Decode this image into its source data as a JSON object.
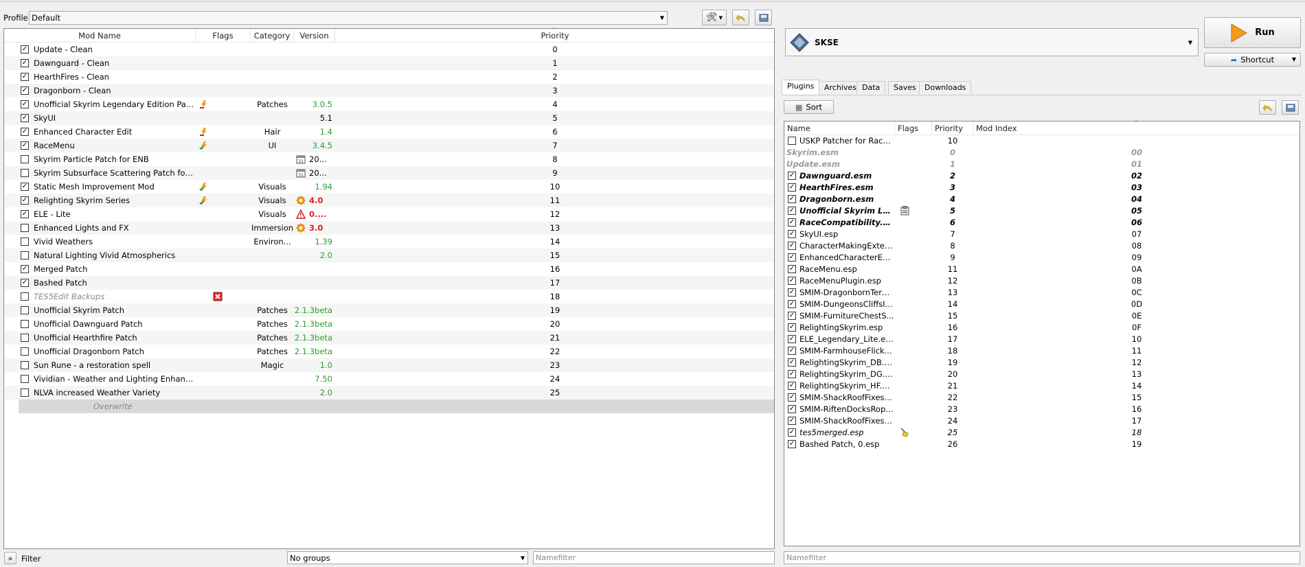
{
  "profile": {
    "label": "Profile",
    "value": "Default"
  },
  "modlist": {
    "columns": {
      "name": "Mod Name",
      "flags": "Flags",
      "category": "Category",
      "version": "Version",
      "priority": "Priority"
    },
    "rows": [
      {
        "checked": true,
        "name": "Update - Clean",
        "flag": "",
        "category": "",
        "version": "",
        "vstyle": "",
        "priority": "0"
      },
      {
        "checked": true,
        "name": "Dawnguard - Clean",
        "flag": "",
        "category": "",
        "version": "",
        "vstyle": "",
        "priority": "1"
      },
      {
        "checked": true,
        "name": "HearthFires - Clean",
        "flag": "",
        "category": "",
        "version": "",
        "vstyle": "",
        "priority": "2"
      },
      {
        "checked": true,
        "name": "Dragonborn - Clean",
        "flag": "",
        "category": "",
        "version": "",
        "vstyle": "",
        "priority": "3"
      },
      {
        "checked": true,
        "name": "Unofficial Skyrim Legendary Edition Patch",
        "flag": "conflict",
        "category": "Patches",
        "version": "3.0.5",
        "vstyle": "green",
        "priority": "4"
      },
      {
        "checked": true,
        "name": "SkyUI",
        "flag": "",
        "category": "",
        "version": "5.1",
        "vstyle": "",
        "priority": "5"
      },
      {
        "checked": true,
        "name": "Enhanced Character Edit",
        "flag": "conflict",
        "category": "Hair",
        "version": "1.4",
        "vstyle": "green",
        "priority": "6"
      },
      {
        "checked": true,
        "name": "RaceMenu",
        "flag": "conflict-green",
        "category": "UI",
        "version": "3.4.5",
        "vstyle": "green",
        "priority": "7"
      },
      {
        "checked": false,
        "name": "Skyrim Particle Patch for ENB",
        "flag": "",
        "category": "",
        "version": "20...",
        "vstyle": "",
        "vicon": "date",
        "priority": "8"
      },
      {
        "checked": false,
        "name": "Skyrim Subsurface Scattering Patch for ENB",
        "flag": "",
        "category": "",
        "version": "20...",
        "vstyle": "",
        "vicon": "date",
        "priority": "9"
      },
      {
        "checked": true,
        "name": "Static Mesh Improvement Mod",
        "flag": "conflict-green",
        "category": "Visuals",
        "version": "1.94",
        "vstyle": "green",
        "priority": "10"
      },
      {
        "checked": true,
        "name": "Relighting Skyrim Series",
        "flag": "conflict-green",
        "category": "Visuals",
        "version": "4.0",
        "vstyle": "red",
        "vicon": "update",
        "priority": "11"
      },
      {
        "checked": true,
        "name": "ELE - Lite",
        "flag": "",
        "category": "Visuals",
        "version": "0....",
        "vstyle": "red",
        "vicon": "warn",
        "priority": "12"
      },
      {
        "checked": false,
        "name": "Enhanced Lights and FX",
        "flag": "",
        "category": "Immersion",
        "version": "3.0",
        "vstyle": "red",
        "vicon": "update",
        "priority": "13"
      },
      {
        "checked": false,
        "name": "Vivid Weathers",
        "flag": "",
        "category": "Environ...",
        "version": "1.39",
        "vstyle": "green",
        "priority": "14"
      },
      {
        "checked": false,
        "name": "Natural Lighting Vivid Atmospherics",
        "flag": "",
        "category": "",
        "version": "2.0",
        "vstyle": "green",
        "priority": "15"
      },
      {
        "checked": true,
        "name": "Merged Patch",
        "flag": "",
        "category": "",
        "version": "",
        "vstyle": "",
        "priority": "16"
      },
      {
        "checked": true,
        "name": "Bashed Patch",
        "flag": "",
        "category": "",
        "version": "",
        "vstyle": "",
        "priority": "17"
      },
      {
        "checked": false,
        "name": "TES5Edit Backups",
        "flag": "invalid",
        "category": "",
        "version": "",
        "vstyle": "",
        "priority": "18",
        "italic": true
      },
      {
        "checked": false,
        "name": "Unofficial Skyrim Patch",
        "flag": "",
        "category": "Patches",
        "version": "2.1.3beta",
        "vstyle": "green",
        "priority": "19"
      },
      {
        "checked": false,
        "name": "Unofficial Dawnguard Patch",
        "flag": "",
        "category": "Patches",
        "version": "2.1.3beta",
        "vstyle": "green",
        "priority": "20"
      },
      {
        "checked": false,
        "name": "Unofficial Hearthfire Patch",
        "flag": "",
        "category": "Patches",
        "version": "2.1.3beta",
        "vstyle": "green",
        "priority": "21"
      },
      {
        "checked": false,
        "name": "Unofficial Dragonborn Patch",
        "flag": "",
        "category": "Patches",
        "version": "2.1.3beta",
        "vstyle": "green",
        "priority": "22"
      },
      {
        "checked": false,
        "name": "Sun Rune - a restoration spell",
        "flag": "",
        "category": "Magic",
        "version": "1.0",
        "vstyle": "green",
        "priority": "23"
      },
      {
        "checked": false,
        "name": "Vividian - Weather and Lighting Enhance...",
        "flag": "",
        "category": "",
        "version": "7.50",
        "vstyle": "green",
        "priority": "24"
      },
      {
        "checked": false,
        "name": "NLVA increased Weather Variety",
        "flag": "",
        "category": "",
        "version": "2.0",
        "vstyle": "green",
        "priority": "25"
      }
    ],
    "overwrite": "Overwrite"
  },
  "filter": {
    "toggle": "»",
    "label": "Filter",
    "groups": "No groups",
    "namefilter_placeholder": "Namefilter"
  },
  "executable": {
    "name": "SKSE",
    "run": "Run",
    "shortcut": "Shortcut"
  },
  "tabs": [
    "Plugins",
    "Archives",
    "Data",
    "Saves",
    "Downloads"
  ],
  "plugins": {
    "sort": "Sort",
    "columns": {
      "name": "Name",
      "flags": "Flags",
      "priority": "Priority",
      "modindex": "Mod Index"
    },
    "rows": [
      {
        "checked": false,
        "name": "USKP Patcher for RaceC...",
        "priority": "10",
        "index": "",
        "style": ""
      },
      {
        "checked": null,
        "name": "Skyrim.esm",
        "priority": "0",
        "index": "00",
        "style": "greybi"
      },
      {
        "checked": null,
        "name": "Update.esm",
        "priority": "1",
        "index": "01",
        "style": "greybi"
      },
      {
        "checked": true,
        "name": "Dawnguard.esm",
        "priority": "2",
        "index": "02",
        "style": "bi"
      },
      {
        "checked": true,
        "name": "HearthFires.esm",
        "priority": "3",
        "index": "03",
        "style": "bi"
      },
      {
        "checked": true,
        "name": "Dragonborn.esm",
        "priority": "4",
        "index": "04",
        "style": "bi"
      },
      {
        "checked": true,
        "name": "Unofficial Skyrim Leg...",
        "priority": "5",
        "index": "05",
        "style": "bi",
        "flag": "clipboard"
      },
      {
        "checked": true,
        "name": "RaceCompatibility.esm",
        "priority": "6",
        "index": "06",
        "style": "bi"
      },
      {
        "checked": true,
        "name": "SkyUI.esp",
        "priority": "7",
        "index": "07",
        "style": ""
      },
      {
        "checked": true,
        "name": "CharacterMakingExtend...",
        "priority": "8",
        "index": "08",
        "style": ""
      },
      {
        "checked": true,
        "name": "EnhancedCharacterEdit....",
        "priority": "9",
        "index": "09",
        "style": ""
      },
      {
        "checked": true,
        "name": "RaceMenu.esp",
        "priority": "11",
        "index": "0A",
        "style": ""
      },
      {
        "checked": true,
        "name": "RaceMenuPlugin.esp",
        "priority": "12",
        "index": "0B",
        "style": ""
      },
      {
        "checked": true,
        "name": "SMIM-DragonbornTern...",
        "priority": "13",
        "index": "0C",
        "style": ""
      },
      {
        "checked": true,
        "name": "SMIM-DungeonsCliffsIc...",
        "priority": "14",
        "index": "0D",
        "style": ""
      },
      {
        "checked": true,
        "name": "SMIM-FurnitureChestS...",
        "priority": "15",
        "index": "0E",
        "style": ""
      },
      {
        "checked": true,
        "name": "RelightingSkyrim.esp",
        "priority": "16",
        "index": "0F",
        "style": ""
      },
      {
        "checked": true,
        "name": "ELE_Legendary_Lite.esp",
        "priority": "17",
        "index": "10",
        "style": ""
      },
      {
        "checked": true,
        "name": "SMIM-FarmhouseFlicke...",
        "priority": "18",
        "index": "11",
        "style": ""
      },
      {
        "checked": true,
        "name": "RelightingSkyrim_DB.esp",
        "priority": "19",
        "index": "12",
        "style": ""
      },
      {
        "checked": true,
        "name": "RelightingSkyrim_DG.esp",
        "priority": "20",
        "index": "13",
        "style": ""
      },
      {
        "checked": true,
        "name": "RelightingSkyrim_HF.esp",
        "priority": "21",
        "index": "14",
        "style": ""
      },
      {
        "checked": true,
        "name": "SMIM-ShackRoofFixes.e...",
        "priority": "22",
        "index": "15",
        "style": ""
      },
      {
        "checked": true,
        "name": "SMIM-RiftenDocksRope...",
        "priority": "23",
        "index": "16",
        "style": ""
      },
      {
        "checked": true,
        "name": "SMIM-ShackRoofFixesD...",
        "priority": "24",
        "index": "17",
        "style": ""
      },
      {
        "checked": true,
        "name": "tes5merged.esp",
        "priority": "25",
        "index": "18",
        "style": "italic",
        "flag": "broom"
      },
      {
        "checked": true,
        "name": "Bashed Patch, 0.esp",
        "priority": "26",
        "index": "19",
        "style": ""
      }
    ],
    "namefilter_placeholder": "Namefilter"
  },
  "colors": {
    "green": "#2b9e2b",
    "red": "#e02020",
    "accent_orange": "#f39a1e"
  }
}
